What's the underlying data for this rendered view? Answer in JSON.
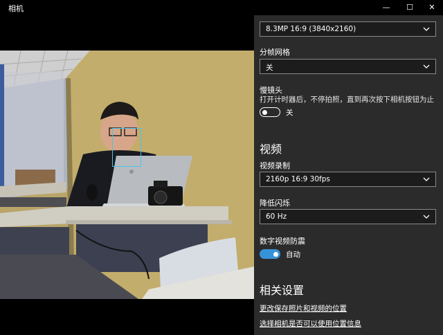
{
  "window": {
    "title": "相机",
    "minimize_glyph": "—",
    "maximize_glyph": "☐",
    "close_glyph": "✕"
  },
  "settings": {
    "photo_resolution": {
      "value": "8.3MP 16:9 (3840x2160)"
    },
    "framing_grid": {
      "label": "分帧网格",
      "value": "关"
    },
    "time_lapse": {
      "label": "慢镜头",
      "description": "打开计时器后，不停拍照，直到再次按下相机按钮为止",
      "state_label": "关",
      "on": false
    },
    "video_heading": "视频",
    "video_recording": {
      "label": "视频录制",
      "value": "2160p 16:9 30fps"
    },
    "flicker_reduction": {
      "label": "降低闪烁",
      "value": "60 Hz"
    },
    "digital_stabilization": {
      "label": "数字视频防震",
      "state_label": "自动",
      "on": true
    },
    "related_heading": "相关设置",
    "links": [
      "更改保存照片和视频的位置",
      "选择相机是否可以使用位置信息"
    ]
  },
  "colors": {
    "panel_bg": "#2b2b2b",
    "accent": "#3793d7",
    "titlebar_bg": "#000000"
  },
  "icons": {
    "dropdown": "chevron-down-icon",
    "face_box": "face-detection-icon"
  }
}
